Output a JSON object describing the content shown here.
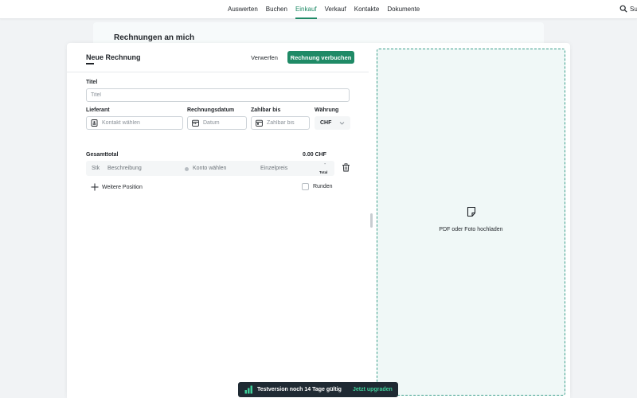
{
  "nav": {
    "items": [
      {
        "label": "Auswerten",
        "active": false
      },
      {
        "label": "Buchen",
        "active": false
      },
      {
        "label": "Einkauf",
        "active": true
      },
      {
        "label": "Verkauf",
        "active": false
      },
      {
        "label": "Kontakte",
        "active": false
      },
      {
        "label": "Dokumente",
        "active": false
      }
    ],
    "search_label": "Su"
  },
  "page": {
    "title": "Rechnungen an mich"
  },
  "modal": {
    "title": "Neue Rechnung",
    "discard_label": "Verwerfen",
    "book_label": "Rechnung verbuchen"
  },
  "form": {
    "title_label": "Titel",
    "title_placeholder": "Titel",
    "supplier_label": "Lieferant",
    "supplier_placeholder": "Kontakt wählen",
    "invoice_date_label": "Rechnungsdatum",
    "invoice_date_placeholder": "Datum",
    "due_label": "Zahlbar bis",
    "due_placeholder": "Zahlbar bis",
    "currency_label": "Währung",
    "currency_value": "CHF"
  },
  "positions": {
    "total_label": "Gesamttotal",
    "total_value": "0.00 CHF",
    "row": {
      "qty": "Stk",
      "description": "Beschreibung",
      "account": "Konto wählen",
      "unit_price": "Einzelpreis",
      "total_dash": "-",
      "total_label": "Total"
    },
    "add_label": "Weitere Position",
    "round_label": "Runden"
  },
  "upload": {
    "label": "PDF oder Foto hochladen"
  },
  "trial": {
    "text": "Testversion noch 14 Tage gültig",
    "link": "Jetzt upgraden"
  },
  "colors": {
    "accent": "#1f8a66",
    "banner": "#1f2a33",
    "banner_link": "#3fcf9a",
    "upload_bg": "#f0f8f7",
    "upload_border": "#3a9e8a"
  }
}
